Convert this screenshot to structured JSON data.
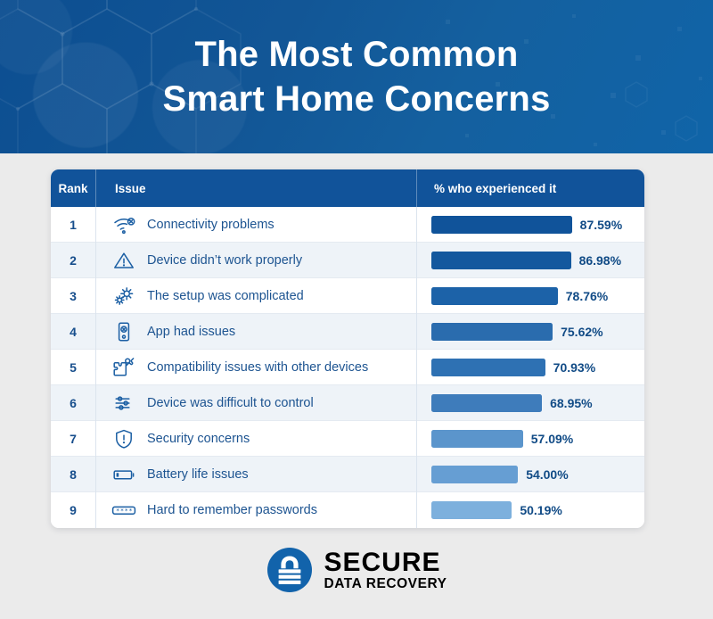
{
  "header": {
    "title_line1": "The Most Common",
    "title_line2": "Smart Home Concerns",
    "background_color": "#11539a"
  },
  "table": {
    "columns": {
      "rank": "Rank",
      "issue": "Issue",
      "percent": "% who experienced it"
    },
    "rows": [
      {
        "rank": "1",
        "icon": "wifi-off-icon",
        "issue": "Connectivity problems",
        "percent": "87.59%",
        "value": 87.59,
        "bar_color": "#10539a"
      },
      {
        "rank": "2",
        "icon": "warning-icon",
        "issue": "Device didn’t work properly",
        "percent": "86.98%",
        "value": 86.98,
        "bar_color": "#14589e"
      },
      {
        "rank": "3",
        "icon": "gears-icon",
        "issue": "The setup was complicated",
        "percent": "78.76%",
        "value": 78.76,
        "bar_color": "#1c62a8"
      },
      {
        "rank": "4",
        "icon": "phone-app-icon",
        "issue": "App had issues",
        "percent": "75.62%",
        "value": 75.62,
        "bar_color": "#2a6cae"
      },
      {
        "rank": "5",
        "icon": "puzzle-icon",
        "issue": "Compatibility issues with other devices",
        "percent": "70.93%",
        "value": 70.93,
        "bar_color": "#2e71b3"
      },
      {
        "rank": "6",
        "icon": "sliders-icon",
        "issue": "Device was difficult to control",
        "percent": "68.95%",
        "value": 68.95,
        "bar_color": "#3e7cbb"
      },
      {
        "rank": "7",
        "icon": "shield-alert-icon",
        "issue": "Security concerns",
        "percent": "57.09%",
        "value": 57.09,
        "bar_color": "#5b95cc"
      },
      {
        "rank": "8",
        "icon": "battery-low-icon",
        "issue": "Battery life issues",
        "percent": "54.00%",
        "value": 54.0,
        "bar_color": "#669ed3"
      },
      {
        "rank": "9",
        "icon": "password-icon",
        "issue": "Hard to remember passwords",
        "percent": "50.19%",
        "value": 50.19,
        "bar_color": "#7db0dd"
      }
    ]
  },
  "chart_data": {
    "type": "bar",
    "title": "The Most Common Smart Home Concerns",
    "xlabel": "% who experienced it",
    "ylabel": "Issue",
    "categories": [
      "Connectivity problems",
      "Device didn’t work properly",
      "The setup was complicated",
      "App had issues",
      "Compatibility issues with other devices",
      "Device was difficult to control",
      "Security concerns",
      "Battery life issues",
      "Hard to remember passwords"
    ],
    "values": [
      87.59,
      86.98,
      78.76,
      75.62,
      70.93,
      68.95,
      57.09,
      54.0,
      50.19
    ],
    "value_labels": [
      "87.59%",
      "86.98%",
      "78.76%",
      "75.62%",
      "70.93%",
      "68.95%",
      "57.09%",
      "54.00%",
      "50.19%"
    ],
    "ranks": [
      1,
      2,
      3,
      4,
      5,
      6,
      7,
      8,
      9
    ],
    "xlim": [
      0,
      100
    ],
    "grid": false,
    "legend": null,
    "orientation": "horizontal"
  },
  "logo": {
    "name_top": "SECURE",
    "name_bottom": "DATA RECOVERY",
    "mark_color": "#1263ab"
  }
}
